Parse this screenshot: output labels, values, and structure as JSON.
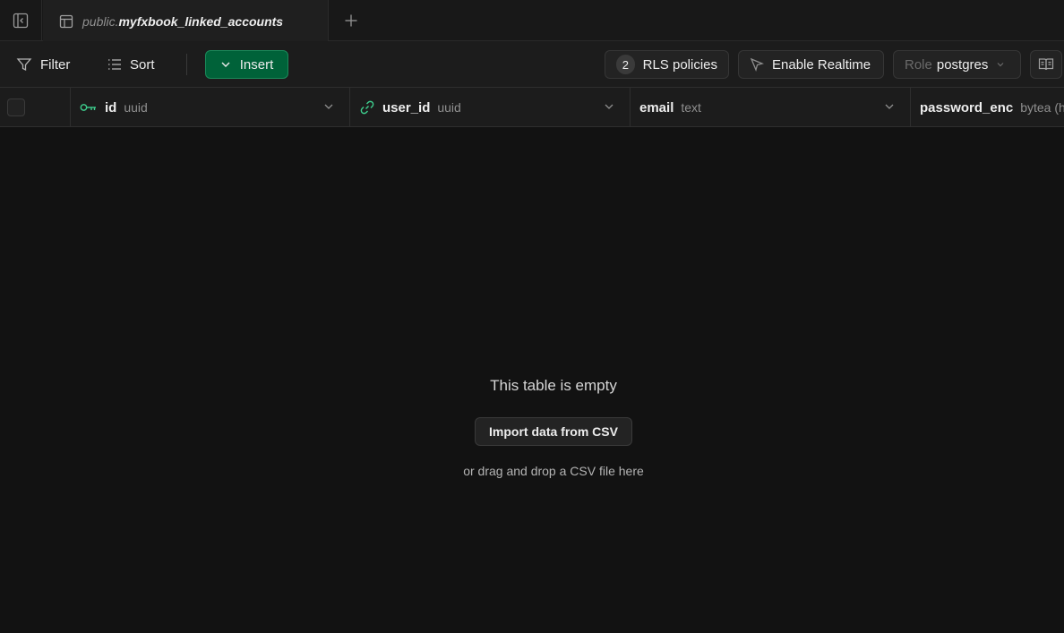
{
  "tab": {
    "schema": "public.",
    "table_name": "myfxbook_linked_accounts"
  },
  "toolbar": {
    "filter_label": "Filter",
    "sort_label": "Sort",
    "insert_label": "Insert",
    "rls_count": "2",
    "rls_label": "RLS policies",
    "realtime_label": "Enable Realtime",
    "role_prefix": "Role",
    "role_value": "postgres"
  },
  "columns": [
    {
      "name": "id",
      "type": "uuid",
      "icon": "key-icon"
    },
    {
      "name": "user_id",
      "type": "uuid",
      "icon": "link-icon"
    },
    {
      "name": "email",
      "type": "text"
    },
    {
      "name": "password_enc",
      "type": "bytea (h"
    }
  ],
  "empty_state": {
    "title": "This table is empty",
    "import_label": "Import data from CSV",
    "hint": "or drag and drop a CSV file here"
  },
  "colors": {
    "background": "#121212",
    "accent_green": "#3ecf8e",
    "insert_button": "#006239"
  }
}
